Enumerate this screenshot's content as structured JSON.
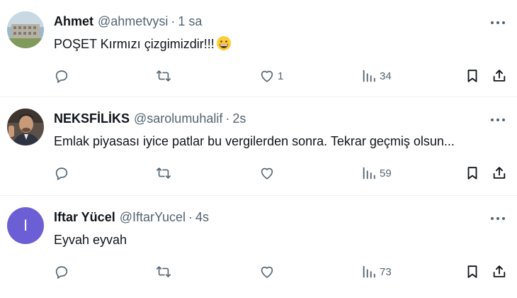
{
  "tweets": [
    {
      "name": "Ahmet",
      "handle": "@ahmetvysi",
      "separator": "·",
      "time": "1 sa",
      "text": "POŞET  Kırmızı çizgimizdir!!!",
      "emoji": "grinning-face-emoji",
      "likes": "1",
      "views": "34",
      "avatar": "building-photo"
    },
    {
      "name": "NEKSFİLİKS",
      "handle": "@sarolumuhalif",
      "separator": "·",
      "time": "2s",
      "text": "Emlak piyasası iyice patlar bu vergilerden sonra. Tekrar geçmiş olsun...",
      "likes": "",
      "views": "59",
      "avatar": "person-photo"
    },
    {
      "name": "Iftar Yücel",
      "handle": "@IftarYucel",
      "separator": "·",
      "time": "4s",
      "text": "Eyvah eyvah",
      "likes": "",
      "views": "73",
      "avatar_letter": "I",
      "avatar_color": "#6c5fd6"
    }
  ],
  "icons": {
    "more": "more-horizontal-icon",
    "reply": "reply-icon",
    "retweet": "retweet-icon",
    "like": "heart-icon",
    "views": "views-icon",
    "bookmark": "bookmark-icon",
    "share": "share-icon"
  },
  "colors": {
    "text": "#0f1419",
    "secondary": "#536471",
    "divider": "#eff3f4"
  }
}
